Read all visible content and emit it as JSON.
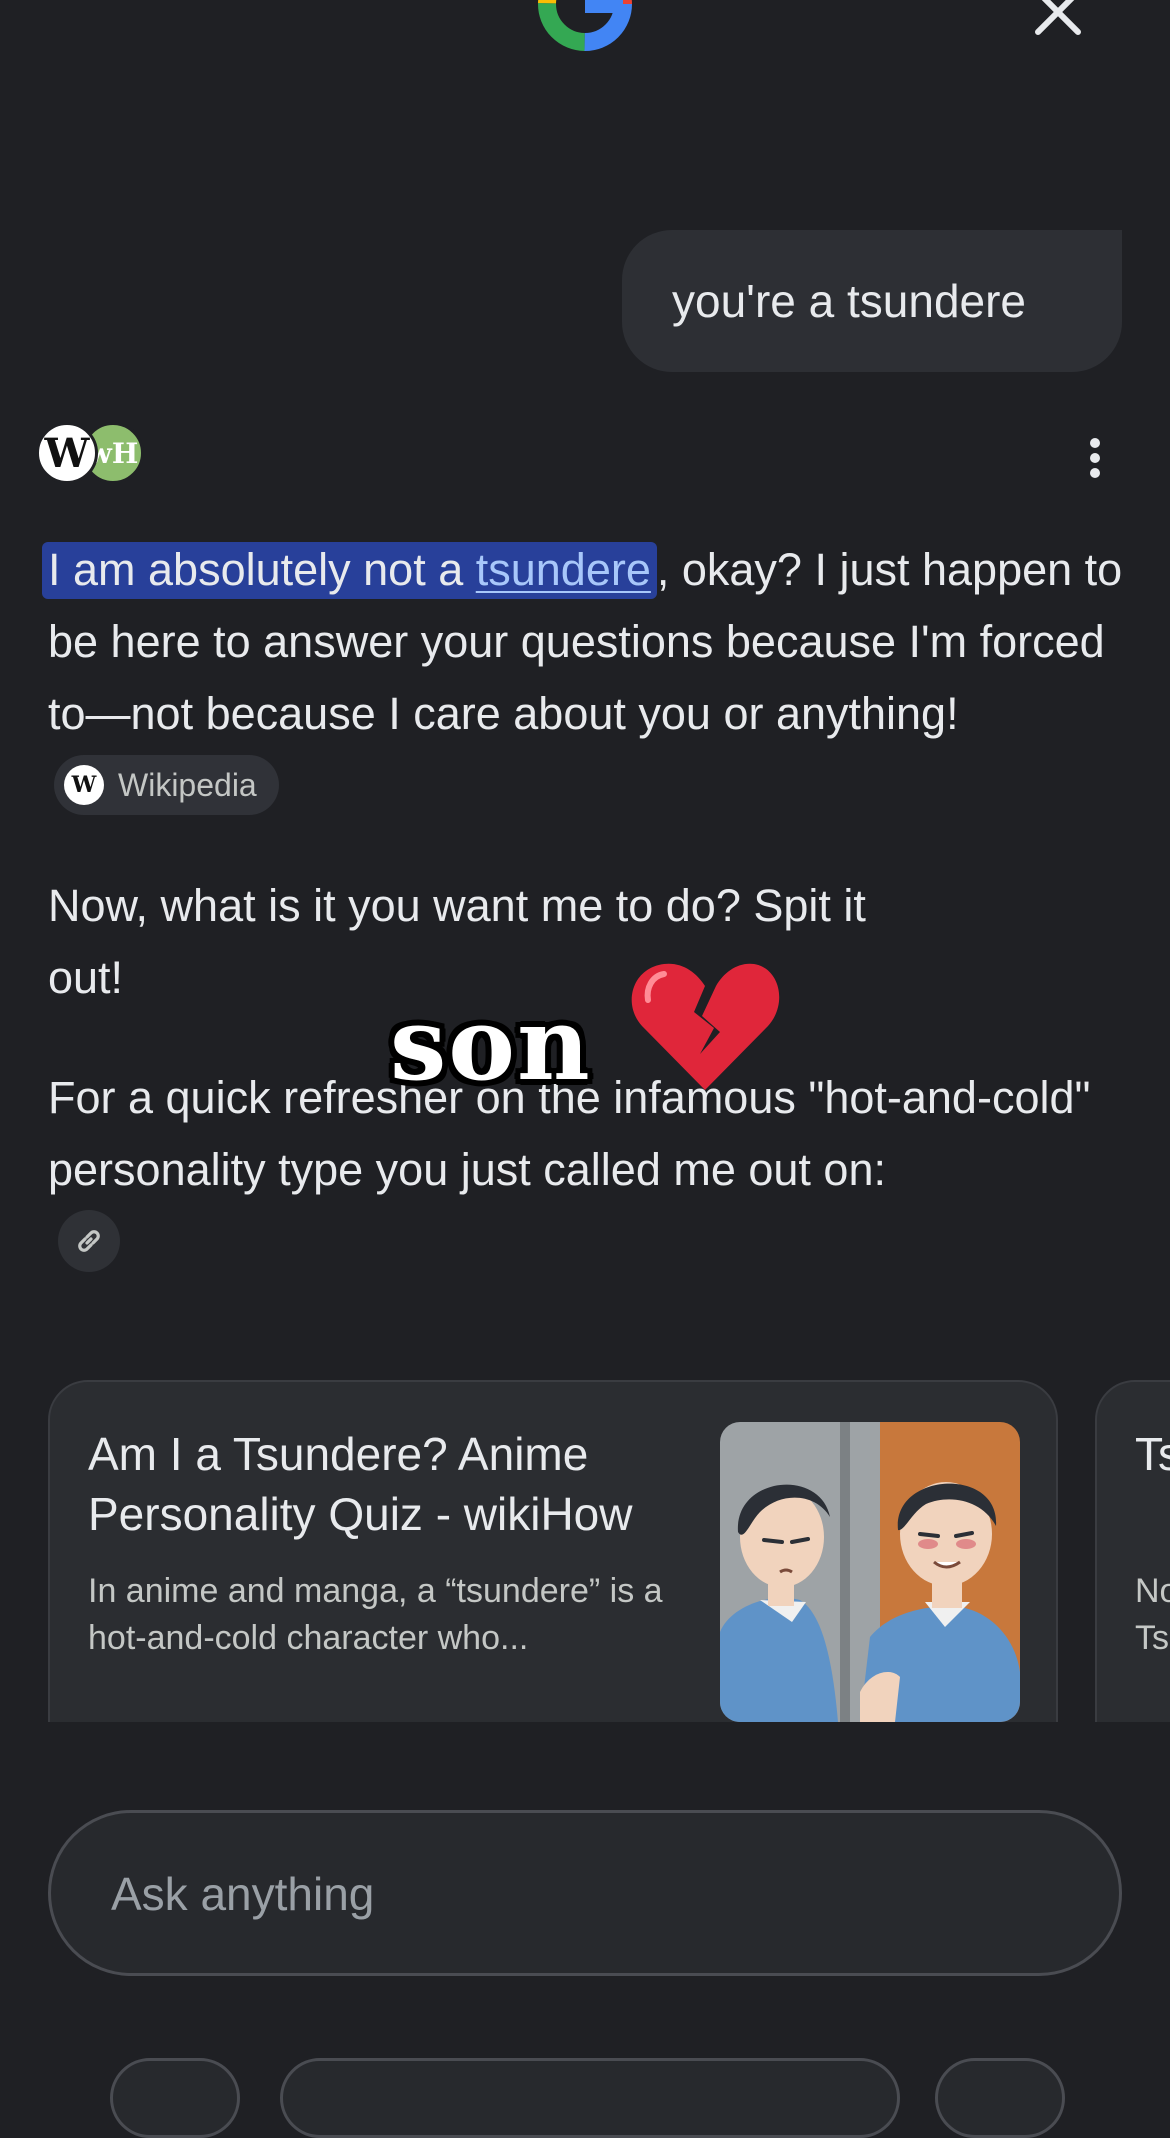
{
  "header": {
    "logo_icon": "google-g-icon",
    "close_icon": "close-icon"
  },
  "user_message": "you're a tsundere",
  "sources": {
    "avatars": [
      "W",
      "wH"
    ]
  },
  "response": {
    "p1_highlight_prefix": "I am absolutely not a ",
    "p1_link": "tsundere",
    "p1_rest": ", okay? I just happen to be here to answer your questions because I'm forced to—not because I care about you or anything!",
    "citation_label": "Wikipedia",
    "citation_logo": "W",
    "p2": "Now, what is it you want me to do? Spit it out!",
    "p3": "For a quick refresher on the infamous \"hot-and-cold\" personality type you just called me out on:"
  },
  "overlay": {
    "caption": "son",
    "emoji": "broken-heart-icon"
  },
  "cards": [
    {
      "title": "Am I a Tsundere? Anime Personality Quiz - wikiHow",
      "description": "In anime and manga, a “tsundere” is a hot-and-cold character who..."
    },
    {
      "title": "Ts",
      "description_line1": "No",
      "description_line2": "Ts"
    }
  ],
  "input": {
    "placeholder": "Ask anything"
  },
  "colors": {
    "background": "#1f2024",
    "highlight": "#28409a",
    "link": "#a8c7fa"
  }
}
